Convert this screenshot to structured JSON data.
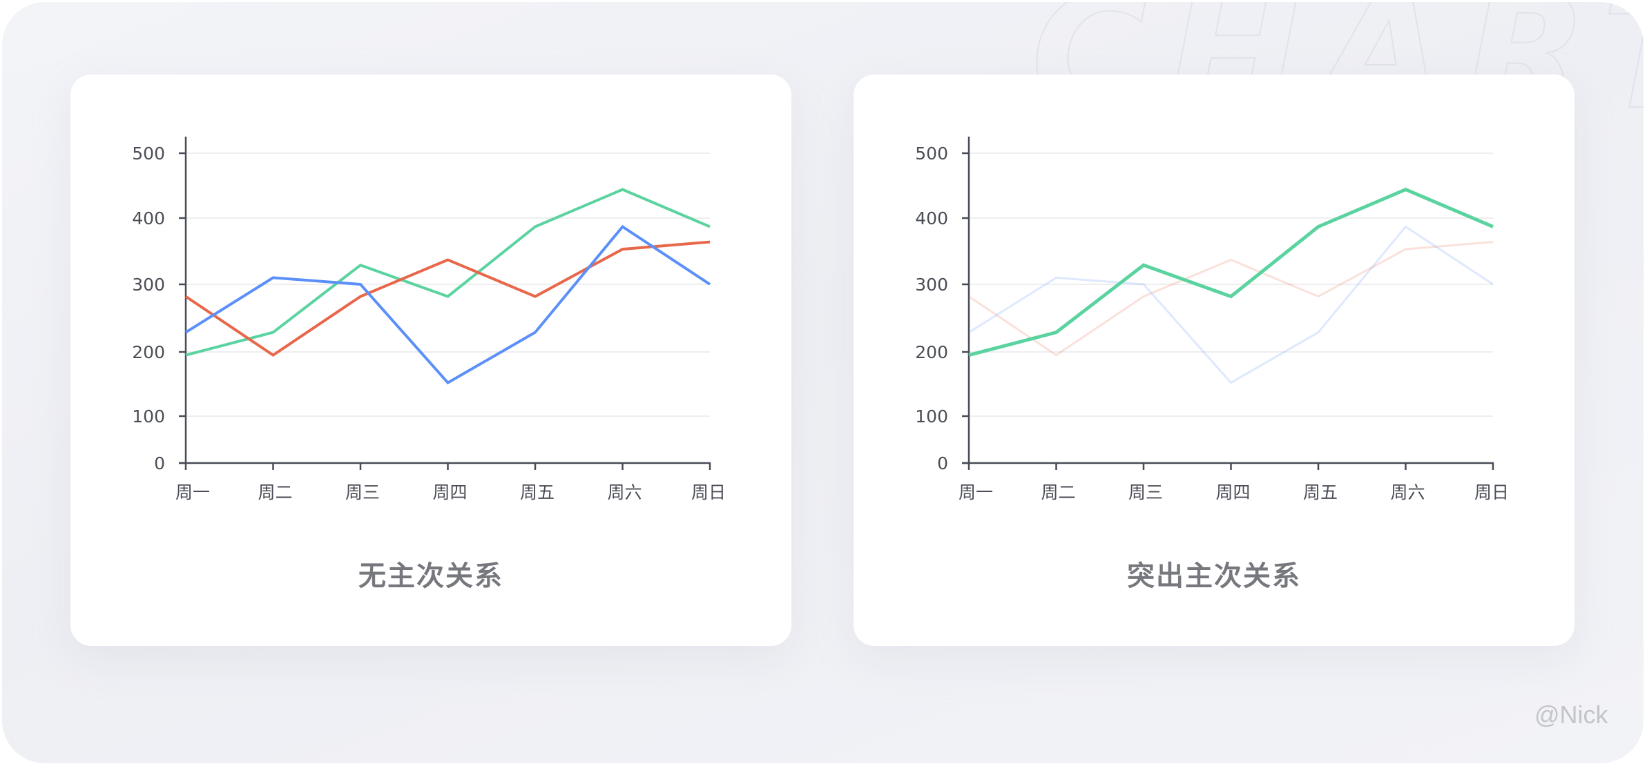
{
  "chart_data": [
    {
      "type": "line",
      "title": "无主次关系",
      "categories": [
        "周一",
        "周二",
        "周三",
        "周四",
        "周五",
        "周六",
        "周日"
      ],
      "yticks": [
        0,
        100,
        200,
        300,
        400,
        500
      ],
      "ylim": [
        0,
        500
      ],
      "xlabel": "",
      "ylabel": "",
      "grid": true,
      "legend": "none",
      "series": [
        {
          "name": "green",
          "color": "#5bd3a0",
          "emphasis": "normal",
          "values": [
            195,
            229,
            329,
            282,
            387,
            444,
            387
          ]
        },
        {
          "name": "red",
          "color": "#e8674a",
          "emphasis": "normal",
          "values": [
            282,
            195,
            282,
            337,
            282,
            353,
            364
          ]
        },
        {
          "name": "blue",
          "color": "#5b8ff9",
          "emphasis": "normal",
          "values": [
            229,
            310,
            300,
            152,
            229,
            387,
            300
          ]
        }
      ]
    },
    {
      "type": "line",
      "title": "突出主次关系",
      "categories": [
        "周一",
        "周二",
        "周三",
        "周四",
        "周五",
        "周六",
        "周日"
      ],
      "yticks": [
        0,
        100,
        200,
        300,
        400,
        500
      ],
      "ylim": [
        0,
        500
      ],
      "xlabel": "",
      "ylabel": "",
      "grid": true,
      "legend": "none",
      "series": [
        {
          "name": "red",
          "color": "#e8674a",
          "emphasis": "faded",
          "values": [
            282,
            195,
            282,
            337,
            282,
            353,
            364
          ]
        },
        {
          "name": "blue",
          "color": "#5b8ff9",
          "emphasis": "faded",
          "values": [
            229,
            310,
            300,
            152,
            229,
            387,
            300
          ]
        },
        {
          "name": "green",
          "color": "#5bd3a0",
          "emphasis": "highlight",
          "values": [
            195,
            229,
            329,
            282,
            387,
            444,
            387
          ]
        }
      ]
    }
  ],
  "cards": {
    "left": {
      "title": "无主次关系"
    },
    "right": {
      "title": "突出主次关系"
    }
  },
  "watermark": "CHART",
  "signature": "@Nick"
}
